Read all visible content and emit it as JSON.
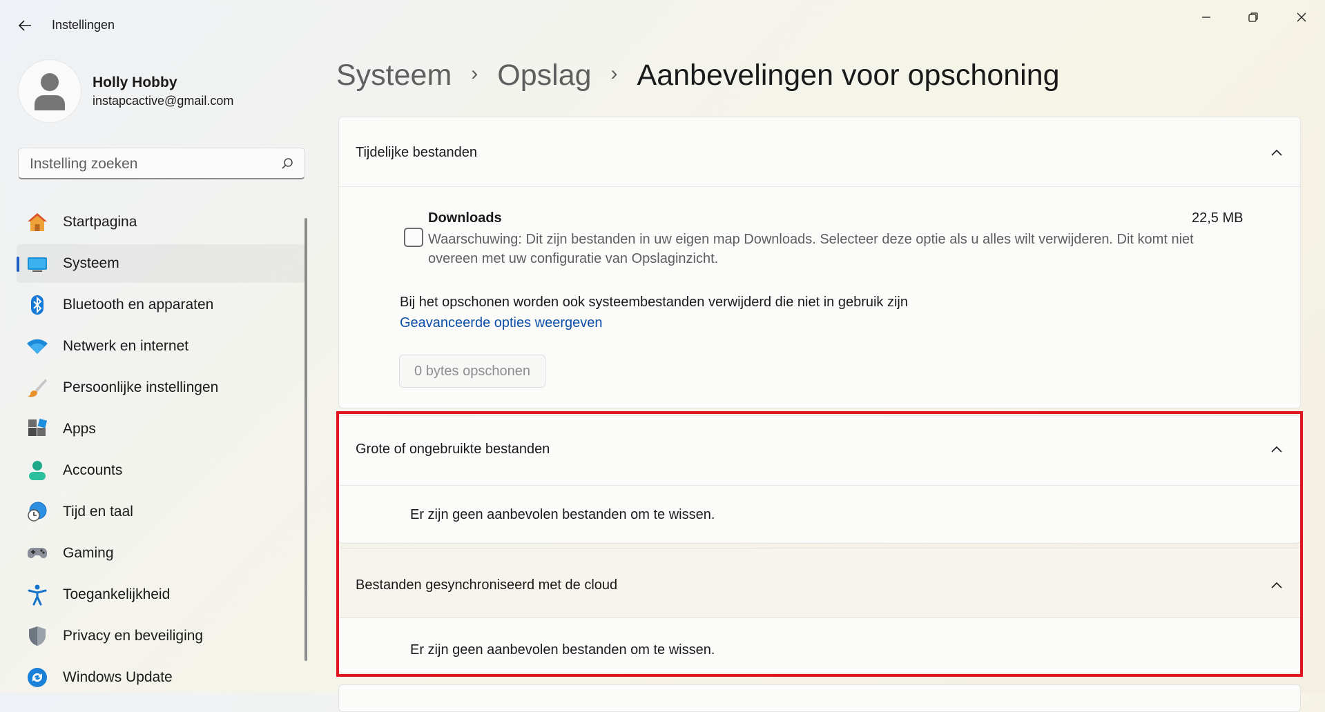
{
  "window": {
    "title": "Instellingen",
    "back_icon": "back-arrow-icon",
    "minimize_icon": "minimize-icon",
    "restore_icon": "restore-icon",
    "close_icon": "close-icon"
  },
  "profile": {
    "name": "Holly Hobby",
    "email": "instapcactive@gmail.com"
  },
  "search": {
    "placeholder": "Instelling zoeken"
  },
  "nav": {
    "items": [
      {
        "label": "Startpagina",
        "icon": "home-icon"
      },
      {
        "label": "Systeem",
        "icon": "system-monitor-icon",
        "active": true
      },
      {
        "label": "Bluetooth en apparaten",
        "icon": "bluetooth-icon"
      },
      {
        "label": "Netwerk en internet",
        "icon": "wifi-icon"
      },
      {
        "label": "Persoonlijke instellingen",
        "icon": "brush-icon"
      },
      {
        "label": "Apps",
        "icon": "apps-icon"
      },
      {
        "label": "Accounts",
        "icon": "accounts-icon"
      },
      {
        "label": "Tijd en taal",
        "icon": "globe-clock-icon"
      },
      {
        "label": "Gaming",
        "icon": "gamepad-icon"
      },
      {
        "label": "Toegankelijkheid",
        "icon": "accessibility-icon"
      },
      {
        "label": "Privacy en beveiliging",
        "icon": "shield-icon"
      },
      {
        "label": "Windows Update",
        "icon": "update-icon"
      }
    ]
  },
  "breadcrumb": {
    "level1": "Systeem",
    "level2": "Opslag",
    "current": "Aanbevelingen voor opschoning",
    "separator": "›"
  },
  "temp_files": {
    "title": "Tijdelijke bestanden",
    "downloads": {
      "title": "Downloads",
      "size": "22,5 MB",
      "warning": "Waarschuwing: Dit zijn bestanden in uw eigen map Downloads. Selecteer deze optie als u alles wilt verwijderen. Dit komt niet overeen met uw configuratie van Opslaginzicht.",
      "checked": false
    },
    "system_note": "Bij het opschonen worden ook systeembestanden verwijderd die niet in gebruik zijn",
    "advanced_link": "Geavanceerde opties weergeven",
    "clean_button": "0 bytes opschonen"
  },
  "large_files": {
    "title": "Grote of ongebruikte bestanden",
    "message": "Er zijn geen aanbevolen bestanden om te wissen."
  },
  "cloud_files": {
    "title": "Bestanden gesynchroniseerd met de cloud",
    "message": "Er zijn geen aanbevolen bestanden om te wissen."
  },
  "colors": {
    "accent": "#1f5cc8",
    "link": "#0a4ea8",
    "highlight_border": "#e0151f"
  }
}
